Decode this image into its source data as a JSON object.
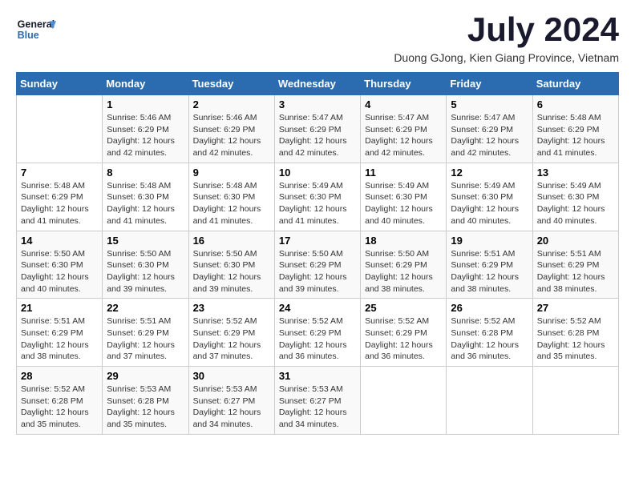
{
  "header": {
    "logo_line1": "General",
    "logo_line2": "Blue",
    "title": "July 2024",
    "subtitle": "Duong GJong, Kien Giang Province, Vietnam"
  },
  "calendar": {
    "weekdays": [
      "Sunday",
      "Monday",
      "Tuesday",
      "Wednesday",
      "Thursday",
      "Friday",
      "Saturday"
    ],
    "weeks": [
      [
        {
          "day": "",
          "detail": ""
        },
        {
          "day": "1",
          "detail": "Sunrise: 5:46 AM\nSunset: 6:29 PM\nDaylight: 12 hours\nand 42 minutes."
        },
        {
          "day": "2",
          "detail": "Sunrise: 5:46 AM\nSunset: 6:29 PM\nDaylight: 12 hours\nand 42 minutes."
        },
        {
          "day": "3",
          "detail": "Sunrise: 5:47 AM\nSunset: 6:29 PM\nDaylight: 12 hours\nand 42 minutes."
        },
        {
          "day": "4",
          "detail": "Sunrise: 5:47 AM\nSunset: 6:29 PM\nDaylight: 12 hours\nand 42 minutes."
        },
        {
          "day": "5",
          "detail": "Sunrise: 5:47 AM\nSunset: 6:29 PM\nDaylight: 12 hours\nand 42 minutes."
        },
        {
          "day": "6",
          "detail": "Sunrise: 5:48 AM\nSunset: 6:29 PM\nDaylight: 12 hours\nand 41 minutes."
        }
      ],
      [
        {
          "day": "7",
          "detail": "Sunrise: 5:48 AM\nSunset: 6:29 PM\nDaylight: 12 hours\nand 41 minutes."
        },
        {
          "day": "8",
          "detail": "Sunrise: 5:48 AM\nSunset: 6:30 PM\nDaylight: 12 hours\nand 41 minutes."
        },
        {
          "day": "9",
          "detail": "Sunrise: 5:48 AM\nSunset: 6:30 PM\nDaylight: 12 hours\nand 41 minutes."
        },
        {
          "day": "10",
          "detail": "Sunrise: 5:49 AM\nSunset: 6:30 PM\nDaylight: 12 hours\nand 41 minutes."
        },
        {
          "day": "11",
          "detail": "Sunrise: 5:49 AM\nSunset: 6:30 PM\nDaylight: 12 hours\nand 40 minutes."
        },
        {
          "day": "12",
          "detail": "Sunrise: 5:49 AM\nSunset: 6:30 PM\nDaylight: 12 hours\nand 40 minutes."
        },
        {
          "day": "13",
          "detail": "Sunrise: 5:49 AM\nSunset: 6:30 PM\nDaylight: 12 hours\nand 40 minutes."
        }
      ],
      [
        {
          "day": "14",
          "detail": "Sunrise: 5:50 AM\nSunset: 6:30 PM\nDaylight: 12 hours\nand 40 minutes."
        },
        {
          "day": "15",
          "detail": "Sunrise: 5:50 AM\nSunset: 6:30 PM\nDaylight: 12 hours\nand 39 minutes."
        },
        {
          "day": "16",
          "detail": "Sunrise: 5:50 AM\nSunset: 6:30 PM\nDaylight: 12 hours\nand 39 minutes."
        },
        {
          "day": "17",
          "detail": "Sunrise: 5:50 AM\nSunset: 6:29 PM\nDaylight: 12 hours\nand 39 minutes."
        },
        {
          "day": "18",
          "detail": "Sunrise: 5:50 AM\nSunset: 6:29 PM\nDaylight: 12 hours\nand 38 minutes."
        },
        {
          "day": "19",
          "detail": "Sunrise: 5:51 AM\nSunset: 6:29 PM\nDaylight: 12 hours\nand 38 minutes."
        },
        {
          "day": "20",
          "detail": "Sunrise: 5:51 AM\nSunset: 6:29 PM\nDaylight: 12 hours\nand 38 minutes."
        }
      ],
      [
        {
          "day": "21",
          "detail": "Sunrise: 5:51 AM\nSunset: 6:29 PM\nDaylight: 12 hours\nand 38 minutes."
        },
        {
          "day": "22",
          "detail": "Sunrise: 5:51 AM\nSunset: 6:29 PM\nDaylight: 12 hours\nand 37 minutes."
        },
        {
          "day": "23",
          "detail": "Sunrise: 5:52 AM\nSunset: 6:29 PM\nDaylight: 12 hours\nand 37 minutes."
        },
        {
          "day": "24",
          "detail": "Sunrise: 5:52 AM\nSunset: 6:29 PM\nDaylight: 12 hours\nand 36 minutes."
        },
        {
          "day": "25",
          "detail": "Sunrise: 5:52 AM\nSunset: 6:29 PM\nDaylight: 12 hours\nand 36 minutes."
        },
        {
          "day": "26",
          "detail": "Sunrise: 5:52 AM\nSunset: 6:28 PM\nDaylight: 12 hours\nand 36 minutes."
        },
        {
          "day": "27",
          "detail": "Sunrise: 5:52 AM\nSunset: 6:28 PM\nDaylight: 12 hours\nand 35 minutes."
        }
      ],
      [
        {
          "day": "28",
          "detail": "Sunrise: 5:52 AM\nSunset: 6:28 PM\nDaylight: 12 hours\nand 35 minutes."
        },
        {
          "day": "29",
          "detail": "Sunrise: 5:53 AM\nSunset: 6:28 PM\nDaylight: 12 hours\nand 35 minutes."
        },
        {
          "day": "30",
          "detail": "Sunrise: 5:53 AM\nSunset: 6:27 PM\nDaylight: 12 hours\nand 34 minutes."
        },
        {
          "day": "31",
          "detail": "Sunrise: 5:53 AM\nSunset: 6:27 PM\nDaylight: 12 hours\nand 34 minutes."
        },
        {
          "day": "",
          "detail": ""
        },
        {
          "day": "",
          "detail": ""
        },
        {
          "day": "",
          "detail": ""
        }
      ]
    ]
  }
}
